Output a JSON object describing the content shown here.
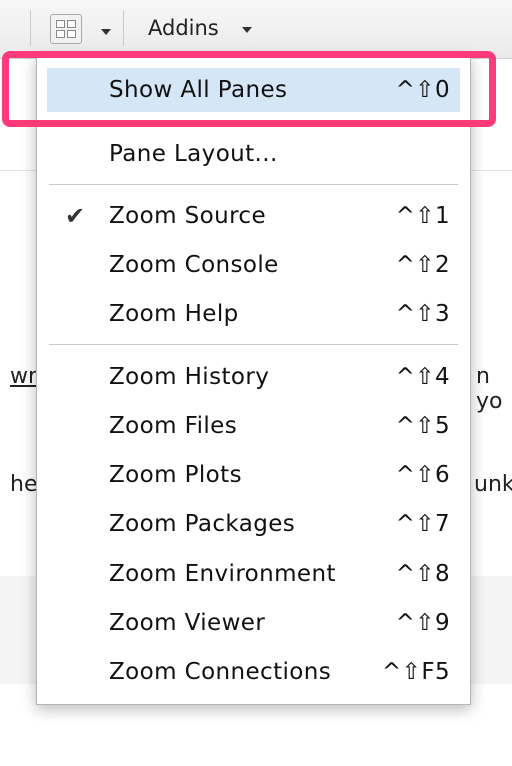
{
  "toolbar": {
    "layout_button_icon": "pane-layout-grid-icon",
    "addins_label": "Addins"
  },
  "background_text": {
    "link_fragment": "wr",
    "fragment_right_1": "n  yo",
    "fragment_left_2": "he",
    "fragment_right_2": "unk"
  },
  "menu": {
    "items": [
      {
        "label": "Show All Panes",
        "shortcut": "^⇧0",
        "highlighted": true
      },
      {
        "label": "Pane Layout...",
        "shortcut": ""
      },
      {
        "label": "Zoom Source",
        "shortcut": "^⇧1",
        "checked": true
      },
      {
        "label": "Zoom Console",
        "shortcut": "^⇧2"
      },
      {
        "label": "Zoom Help",
        "shortcut": "^⇧3"
      },
      {
        "label": "Zoom History",
        "shortcut": "^⇧4"
      },
      {
        "label": "Zoom Files",
        "shortcut": "^⇧5"
      },
      {
        "label": "Zoom Plots",
        "shortcut": "^⇧6"
      },
      {
        "label": "Zoom Packages",
        "shortcut": "^⇧7"
      },
      {
        "label": "Zoom Environment",
        "shortcut": "^⇧8"
      },
      {
        "label": "Zoom Viewer",
        "shortcut": "^⇧9"
      },
      {
        "label": "Zoom Connections",
        "shortcut": "^⇧F5"
      }
    ],
    "check_glyph": "✔"
  },
  "colors": {
    "highlight": "#d5e6f7",
    "callout": "#ff3a7a"
  }
}
